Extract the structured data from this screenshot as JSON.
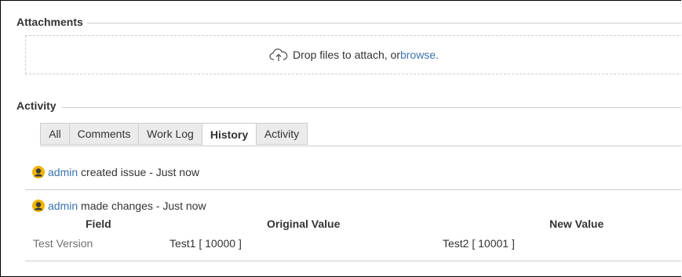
{
  "attachments": {
    "title": "Attachments",
    "drop_text": "Drop files to attach, or ",
    "browse_link": "browse."
  },
  "activity": {
    "title": "Activity",
    "tabs": [
      {
        "label": "All",
        "active": false
      },
      {
        "label": "Comments",
        "active": false
      },
      {
        "label": "Work Log",
        "active": false
      },
      {
        "label": "History",
        "active": true
      },
      {
        "label": "Activity",
        "active": false
      }
    ]
  },
  "history": {
    "entries": [
      {
        "user": "admin",
        "action": " created issue - Just now"
      },
      {
        "user": "admin",
        "action": " made changes - Just now"
      }
    ],
    "table": {
      "headers": [
        "Field",
        "Original Value",
        "New Value"
      ],
      "rows": [
        {
          "field": "Test Version",
          "original": "Test1 [ 10000 ]",
          "new": "Test2 [ 10001 ]"
        }
      ]
    }
  },
  "colors": {
    "link": "#3b73af",
    "border": "#cccccc",
    "tab_bg": "#ebebeb",
    "avatar": "#f0b400"
  }
}
